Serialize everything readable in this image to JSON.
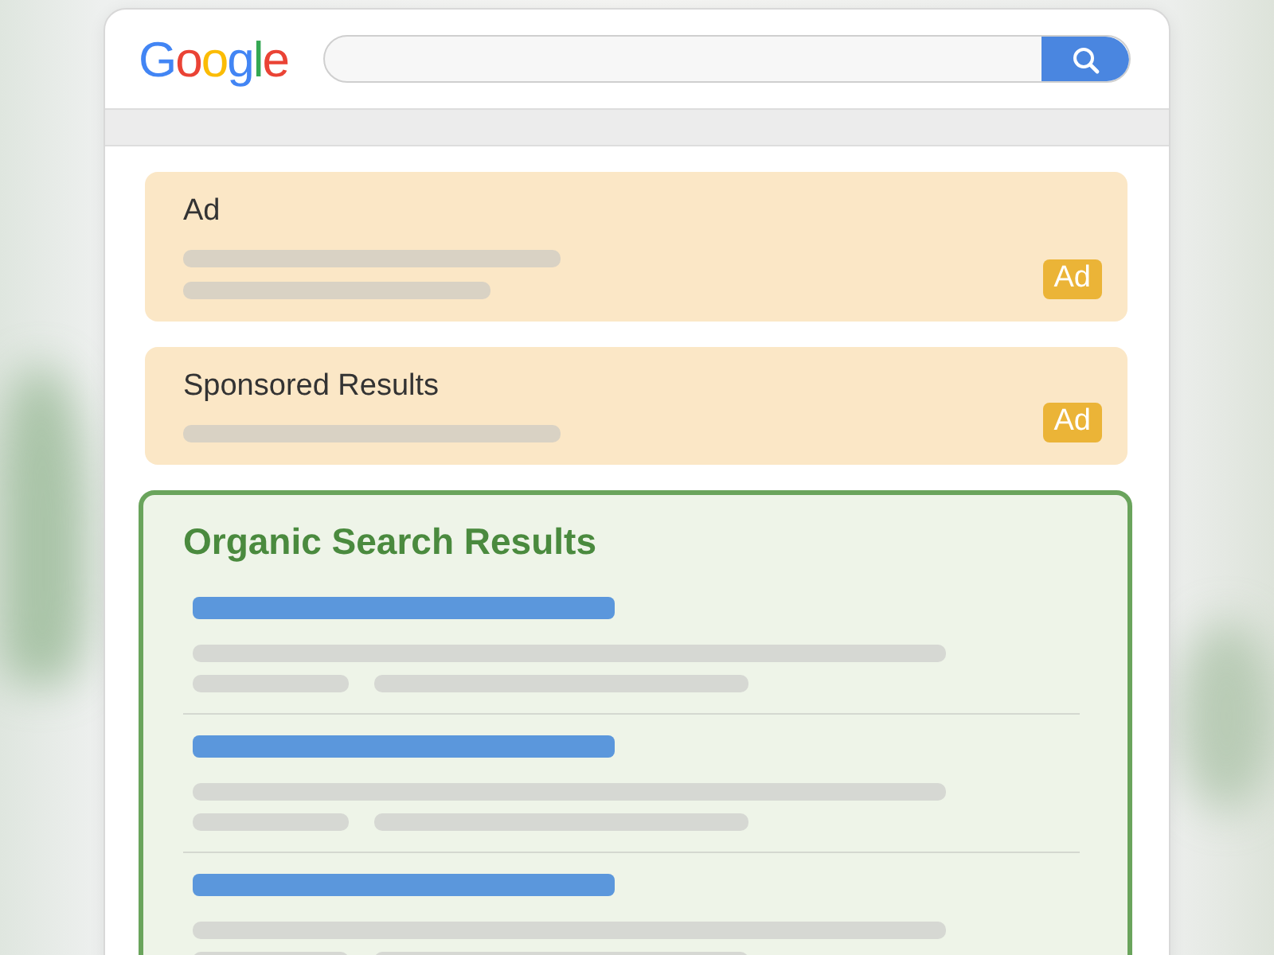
{
  "header": {
    "logo": "Google"
  },
  "ads": [
    {
      "title": "Ad",
      "badge": "Ad",
      "kind": "two-line"
    },
    {
      "title": "Sponsored Results",
      "badge": "Ad",
      "kind": "one-line"
    }
  ],
  "organic": {
    "title": "Organic Search Results",
    "results": [
      {
        "kind": "result"
      },
      {
        "kind": "result"
      },
      {
        "kind": "result"
      }
    ]
  }
}
